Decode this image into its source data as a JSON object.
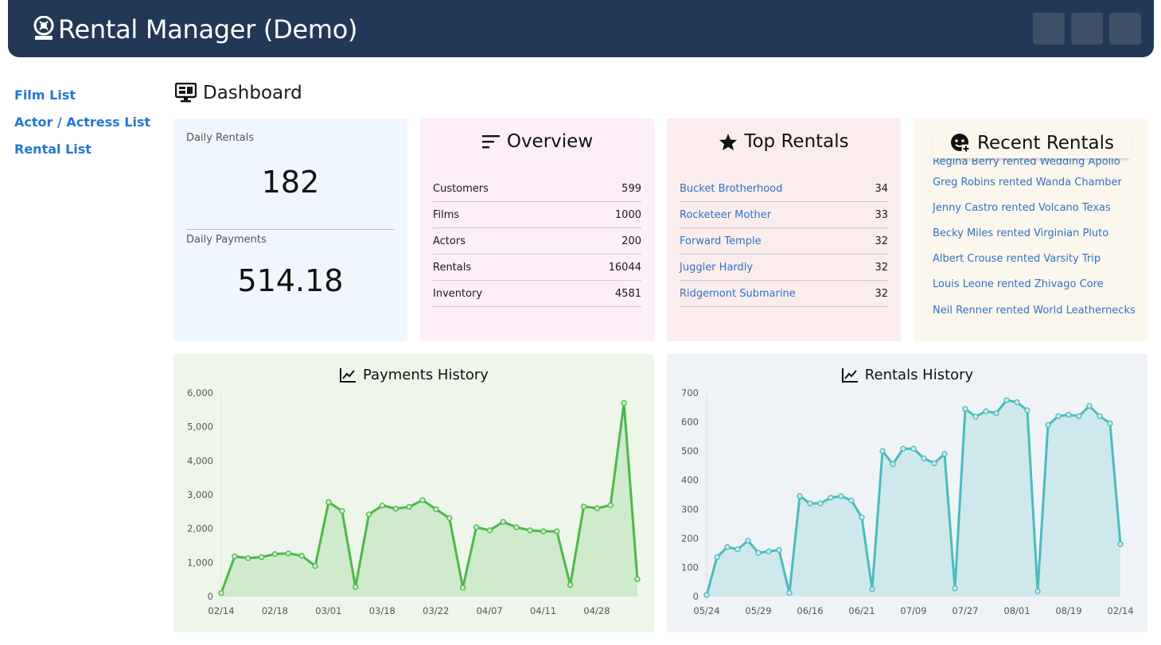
{
  "app": {
    "title": "Rental Manager (Demo)",
    "logo_icon": "film-reel-icon"
  },
  "header_buttons": [
    "header-button-1",
    "header-button-2",
    "header-button-3"
  ],
  "nav": {
    "items": [
      "Film List",
      "Actor / Actress List",
      "Rental List"
    ]
  },
  "page": {
    "title": "Dashboard",
    "icon": "monitor-icon"
  },
  "daily": {
    "rentals_label": "Daily Rentals",
    "rentals_value": "182",
    "payments_label": "Daily Payments",
    "payments_value": "514.18"
  },
  "overview": {
    "title": "Overview",
    "rows": [
      {
        "label": "Customers",
        "value": "599"
      },
      {
        "label": "Films",
        "value": "1000"
      },
      {
        "label": "Actors",
        "value": "200"
      },
      {
        "label": "Rentals",
        "value": "16044"
      },
      {
        "label": "Inventory",
        "value": "4581"
      }
    ]
  },
  "top_rentals": {
    "title": "Top Rentals",
    "rows": [
      {
        "label": "Bucket Brotherhood",
        "value": "34"
      },
      {
        "label": "Rocketeer Mother",
        "value": "33"
      },
      {
        "label": "Forward Temple",
        "value": "32"
      },
      {
        "label": "Juggler Hardly",
        "value": "32"
      },
      {
        "label": "Ridgemont Submarine",
        "value": "32"
      }
    ]
  },
  "recent_rentals": {
    "title": "Recent Rentals",
    "items": [
      "Regina Berry rented Wedding Apollo",
      "Greg Robins rented Wanda Chamber",
      "Jenny Castro rented Volcano Texas",
      "Becky Miles rented Virginian Pluto",
      "Albert Crouse rented Varsity Trip",
      "Louis Leone rented Zhivago Core",
      "Neil Renner rented World Leathernecks"
    ]
  },
  "colors": {
    "header_bg": "#233856",
    "link": "#2477d4",
    "payments_line": "#4cb84a",
    "payments_fill": "#cfeacc",
    "rentals_line": "#4bbcbc",
    "rentals_fill": "#cfe8ec"
  },
  "chart_data": [
    {
      "type": "area",
      "title": "Payments History",
      "x_ticks": [
        "02/14",
        "02/18",
        "03/01",
        "03/18",
        "03/22",
        "04/07",
        "04/11",
        "04/28"
      ],
      "y_ticks": [
        "0",
        "1,000",
        "2,000",
        "3,000",
        "4,000",
        "5,000",
        "6,000"
      ],
      "ylim": [
        0,
        6000
      ],
      "series": [
        {
          "values": [
            100,
            1180,
            1130,
            1160,
            1250,
            1270,
            1200,
            900,
            2780,
            2520,
            280,
            2420,
            2680,
            2590,
            2640,
            2840,
            2570,
            2310,
            260,
            2040,
            1950,
            2200,
            2040,
            1950,
            1920,
            1920,
            340,
            2650,
            2600,
            2690,
            5700,
            510
          ]
        }
      ],
      "grid": false
    },
    {
      "type": "area",
      "title": "Rentals History",
      "x_ticks": [
        "05/24",
        "05/29",
        "06/16",
        "06/21",
        "07/09",
        "07/27",
        "08/01",
        "08/19",
        "02/14"
      ],
      "y_ticks": [
        "0",
        "100",
        "200",
        "300",
        "400",
        "500",
        "600",
        "700"
      ],
      "ylim": [
        0,
        700
      ],
      "series": [
        {
          "values": [
            5,
            135,
            170,
            162,
            192,
            150,
            155,
            160,
            12,
            345,
            320,
            320,
            340,
            345,
            330,
            272,
            25,
            500,
            455,
            508,
            508,
            475,
            458,
            490,
            28,
            645,
            618,
            637,
            630,
            675,
            668,
            640,
            18,
            590,
            620,
            625,
            620,
            655,
            620,
            595,
            180
          ]
        }
      ],
      "grid": false
    }
  ]
}
